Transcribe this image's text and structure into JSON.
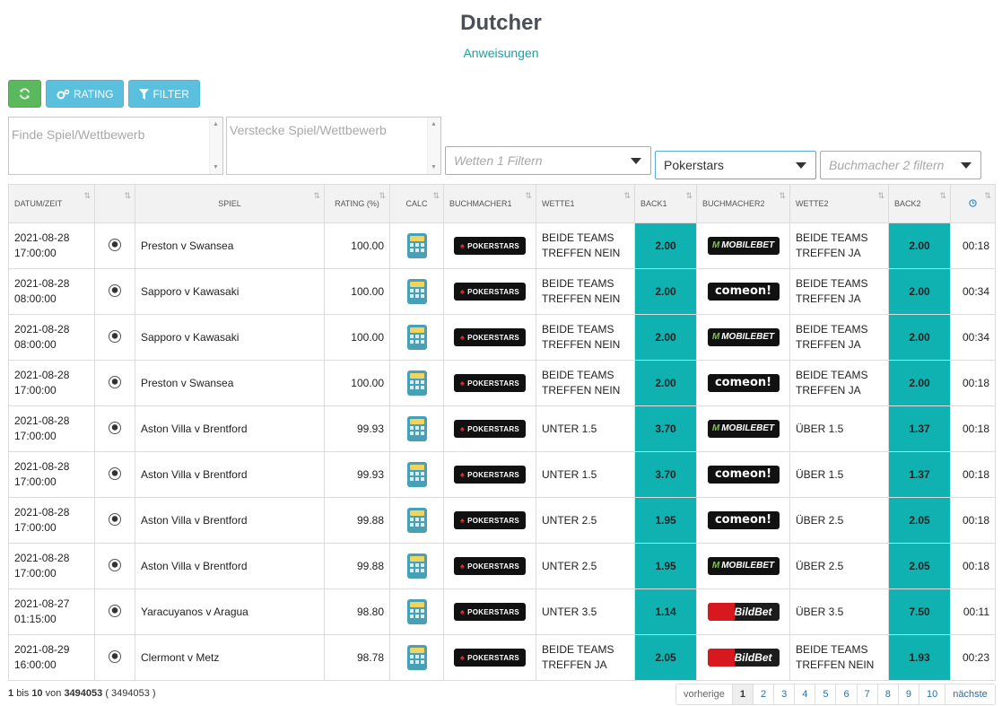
{
  "header": {
    "title": "Dutcher",
    "instructions_link": "Anweisungen"
  },
  "toolbar": {
    "refresh_icon": "refresh-icon",
    "rating_label": "RATING",
    "filter_label": "FILTER"
  },
  "filters": {
    "find_placeholder": "Finde Spiel/Wettbewerb",
    "hide_placeholder": "Verstecke Spiel/Wettbewerb",
    "bet1_placeholder": "Wetten 1 Filtern",
    "bookmaker1_value": "Pokerstars",
    "bookmaker2_placeholder": "Buchmacher 2 filtern"
  },
  "table": {
    "columns": [
      "DATUM/ZEIT",
      "",
      "SPIEL",
      "RATING (%)",
      "CALC",
      "BUCHMACHER1",
      "WETTE1",
      "BACK1",
      "BUCHMACHER2",
      "WETTE2",
      "BACK2",
      ""
    ],
    "rows": [
      {
        "date": "2021-08-28",
        "time": "17:00:00",
        "game": "Preston v Swansea",
        "rating": "100.00",
        "bm1": "POKERSTARS",
        "bet1": "BEIDE TEAMS TREFFEN NEIN",
        "back1": "2.00",
        "bm2": "MOBILEBET",
        "bet2": "BEIDE TEAMS TREFFEN JA",
        "back2": "2.00",
        "age": "00:18"
      },
      {
        "date": "2021-08-28",
        "time": "08:00:00",
        "game": "Sapporo v Kawasaki",
        "rating": "100.00",
        "bm1": "POKERSTARS",
        "bet1": "BEIDE TEAMS TREFFEN NEIN",
        "back1": "2.00",
        "bm2": "comeon!",
        "bet2": "BEIDE TEAMS TREFFEN JA",
        "back2": "2.00",
        "age": "00:34"
      },
      {
        "date": "2021-08-28",
        "time": "08:00:00",
        "game": "Sapporo v Kawasaki",
        "rating": "100.00",
        "bm1": "POKERSTARS",
        "bet1": "BEIDE TEAMS TREFFEN NEIN",
        "back1": "2.00",
        "bm2": "MOBILEBET",
        "bet2": "BEIDE TEAMS TREFFEN JA",
        "back2": "2.00",
        "age": "00:34"
      },
      {
        "date": "2021-08-28",
        "time": "17:00:00",
        "game": "Preston v Swansea",
        "rating": "100.00",
        "bm1": "POKERSTARS",
        "bet1": "BEIDE TEAMS TREFFEN NEIN",
        "back1": "2.00",
        "bm2": "comeon!",
        "bet2": "BEIDE TEAMS TREFFEN JA",
        "back2": "2.00",
        "age": "00:18"
      },
      {
        "date": "2021-08-28",
        "time": "17:00:00",
        "game": "Aston Villa v Brentford",
        "rating": "99.93",
        "bm1": "POKERSTARS",
        "bet1": "UNTER 1.5",
        "back1": "3.70",
        "bm2": "MOBILEBET",
        "bet2": "ÜBER 1.5",
        "back2": "1.37",
        "age": "00:18"
      },
      {
        "date": "2021-08-28",
        "time": "17:00:00",
        "game": "Aston Villa v Brentford",
        "rating": "99.93",
        "bm1": "POKERSTARS",
        "bet1": "UNTER 1.5",
        "back1": "3.70",
        "bm2": "comeon!",
        "bet2": "ÜBER 1.5",
        "back2": "1.37",
        "age": "00:18"
      },
      {
        "date": "2021-08-28",
        "time": "17:00:00",
        "game": "Aston Villa v Brentford",
        "rating": "99.88",
        "bm1": "POKERSTARS",
        "bet1": "UNTER 2.5",
        "back1": "1.95",
        "bm2": "comeon!",
        "bet2": "ÜBER 2.5",
        "back2": "2.05",
        "age": "00:18"
      },
      {
        "date": "2021-08-28",
        "time": "17:00:00",
        "game": "Aston Villa v Brentford",
        "rating": "99.88",
        "bm1": "POKERSTARS",
        "bet1": "UNTER 2.5",
        "back1": "1.95",
        "bm2": "MOBILEBET",
        "bet2": "ÜBER 2.5",
        "back2": "2.05",
        "age": "00:18"
      },
      {
        "date": "2021-08-27",
        "time": "01:15:00",
        "game": "Yaracuyanos v Aragua",
        "rating": "98.80",
        "bm1": "POKERSTARS",
        "bet1": "UNTER 3.5",
        "back1": "1.14",
        "bm2": "BildBet",
        "bet2": "ÜBER 3.5",
        "back2": "7.50",
        "age": "00:11"
      },
      {
        "date": "2021-08-29",
        "time": "16:00:00",
        "game": "Clermont v Metz",
        "rating": "98.78",
        "bm1": "POKERSTARS",
        "bet1": "BEIDE TEAMS TREFFEN JA",
        "back1": "2.05",
        "bm2": "BildBet",
        "bet2": "BEIDE TEAMS TREFFEN NEIN",
        "back2": "1.93",
        "age": "00:23"
      }
    ]
  },
  "footer": {
    "from": "1",
    "bis_word": "bis",
    "to": "10",
    "von_word": "von",
    "total": "3494053",
    "total_paren": "( 3494053 )",
    "prev": "vorherige",
    "pages": [
      "1",
      "2",
      "3",
      "4",
      "5",
      "6",
      "7",
      "8",
      "9",
      "10"
    ],
    "next": "nächste"
  },
  "colors": {
    "accent": "#0fb1b1",
    "green_button": "#5cb85c",
    "blue_button": "#5bc0de",
    "link": "#17a3a3"
  }
}
